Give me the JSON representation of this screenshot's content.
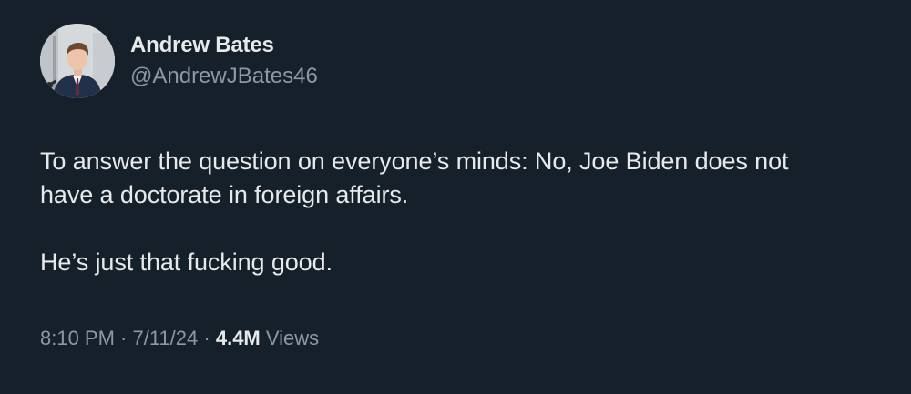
{
  "author": {
    "display_name": "Andrew Bates",
    "handle": "@AndrewJBates46"
  },
  "tweet": {
    "line1": "To answer the question on everyone’s minds: No, Joe Biden does not",
    "line2": "have a doctorate in foreign affairs.",
    "line3": "He’s just that fucking good."
  },
  "meta": {
    "time": "8:10 PM",
    "sep1": " · ",
    "date": "7/11/24",
    "sep2": " · ",
    "views_count": "4.4M",
    "views_label": " Views"
  },
  "colors": {
    "background": "#15202b",
    "primary_text": "#e7e9ea",
    "secondary_text": "#8b98a5"
  }
}
